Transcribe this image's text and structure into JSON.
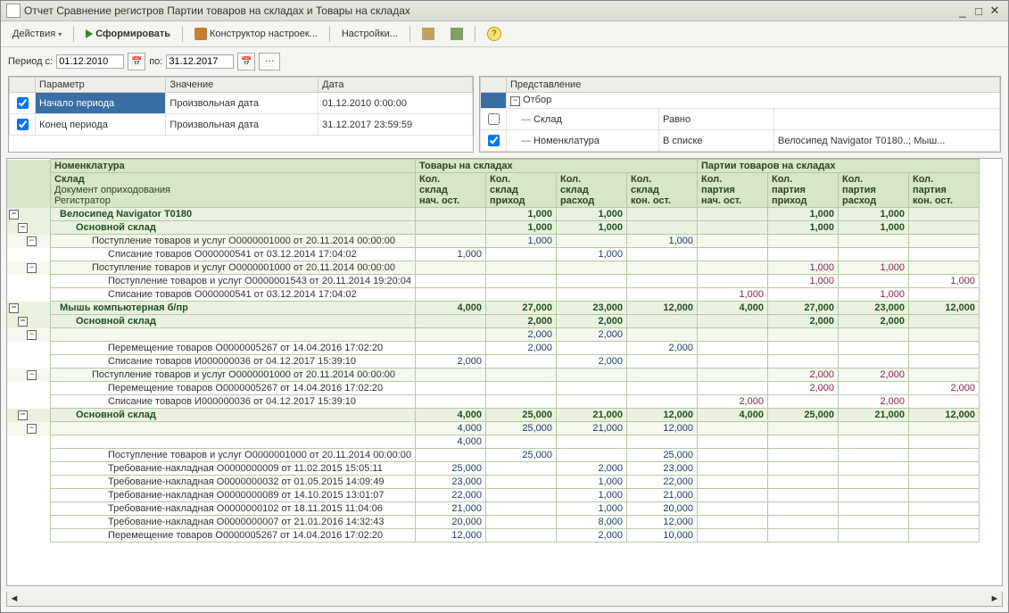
{
  "window": {
    "title": "Отчет  Сравнение регистров Партии товаров на складах и Товары на складах"
  },
  "toolbar": {
    "actions": "Действия",
    "form": "Сформировать",
    "constructor": "Конструктор настроек...",
    "settings": "Настройки..."
  },
  "period": {
    "label_from": "Период с:",
    "from": "01.12.2010",
    "label_to": "по:",
    "to": "31.12.2017"
  },
  "left_panel": {
    "h_param": "Параметр",
    "h_value": "Значение",
    "h_date": "Дата",
    "rows": [
      {
        "chk": true,
        "param": "Начало периода",
        "value": "Произвольная дата",
        "date": "01.12.2010 0:00:00",
        "sel": true
      },
      {
        "chk": true,
        "param": "Конец периода",
        "value": "Произвольная дата",
        "date": "31.12.2017 23:59:59"
      }
    ]
  },
  "right_panel": {
    "h_view": "Представление",
    "root": "Отбор",
    "rows": [
      {
        "chk": false,
        "name": "Склад",
        "comp": "Равно",
        "val": ""
      },
      {
        "chk": true,
        "name": "Номенклатура",
        "comp": "В списке",
        "val": "Велосипед Navigator Т0180..; Мыш..."
      }
    ]
  },
  "report": {
    "head_col1": [
      "Номенклатура",
      "Склад",
      "Документ оприходования",
      "Регистратор"
    ],
    "group1": "Товары на складах",
    "group2": "Партии товаров на складах",
    "cols_g1": [
      "Кол. склад нач. ост.",
      "Кол. склад приход",
      "Кол. склад расход",
      "Кол. склад кон. ост."
    ],
    "cols_g2": [
      "Кол. партия нач. ост.",
      "Кол. партия приход",
      "Кол. партия расход",
      "Кол. партия кон. ост."
    ],
    "rows": [
      {
        "lvl": 0,
        "label": "Велосипед Navigator Т0180",
        "v": [
          "",
          "1,000",
          "1,000",
          "",
          "",
          "1,000",
          "1,000",
          ""
        ],
        "p": [
          0,
          0,
          0,
          0,
          0,
          1,
          1,
          0
        ]
      },
      {
        "lvl": 1,
        "label": "Основной склад",
        "v": [
          "",
          "1,000",
          "1,000",
          "",
          "",
          "1,000",
          "1,000",
          ""
        ],
        "p": [
          0,
          0,
          0,
          0,
          0,
          1,
          1,
          0
        ]
      },
      {
        "lvl": 2,
        "label": "Поступление товаров и услуг О0000001000 от 20.11.2014 00:00:00",
        "v": [
          "",
          "1,000",
          "",
          "1,000",
          "",
          "",
          "",
          ""
        ]
      },
      {
        "lvl": 3,
        "label": "Списание товаров О000000541 от 03.12.2014 17:04:02",
        "v": [
          "1,000",
          "",
          "1,000",
          "",
          "",
          "",
          "",
          ""
        ]
      },
      {
        "lvl": 2,
        "label": "Поступление товаров и услуг О0000001000 от 20.11.2014 00:00:00",
        "v": [
          "",
          "",
          "",
          "",
          "",
          "1,000",
          "1,000",
          ""
        ],
        "p": [
          0,
          0,
          0,
          0,
          0,
          1,
          1,
          0
        ]
      },
      {
        "lvl": 3,
        "label": "Поступление товаров и услуг О0000001543 от 20.11.2014 19:20:04",
        "v": [
          "",
          "",
          "",
          "",
          "",
          "1,000",
          "",
          "1,000"
        ],
        "p": [
          0,
          0,
          0,
          0,
          0,
          1,
          0,
          1
        ]
      },
      {
        "lvl": 3,
        "label": "Списание товаров О000000541 от 03.12.2014 17:04:02",
        "v": [
          "",
          "",
          "",
          "",
          "1,000",
          "",
          "1,000",
          ""
        ],
        "p": [
          0,
          0,
          0,
          0,
          1,
          0,
          1,
          0
        ]
      },
      {
        "lvl": 0,
        "label": "Мышь компьютерная б/пр",
        "v": [
          "4,000",
          "27,000",
          "23,000",
          "12,000",
          "4,000",
          "27,000",
          "23,000",
          "12,000"
        ],
        "p": [
          0,
          0,
          0,
          0,
          1,
          1,
          1,
          1
        ]
      },
      {
        "lvl": 1,
        "label": "Основной склад",
        "v": [
          "",
          "2,000",
          "2,000",
          "",
          "",
          "2,000",
          "2,000",
          ""
        ],
        "p": [
          0,
          0,
          0,
          0,
          0,
          1,
          1,
          0
        ]
      },
      {
        "lvl": 2,
        "label": "",
        "v": [
          "",
          "2,000",
          "2,000",
          "",
          "",
          "",
          "",
          ""
        ]
      },
      {
        "lvl": 3,
        "label": "Перемещение товаров О0000005267 от 14.04.2016 17:02:20",
        "v": [
          "",
          "2,000",
          "",
          "2,000",
          "",
          "",
          "",
          ""
        ]
      },
      {
        "lvl": 3,
        "label": "Списание товаров И000000036 от 04.12.2017 15:39:10",
        "v": [
          "2,000",
          "",
          "2,000",
          "",
          "",
          "",
          "",
          ""
        ]
      },
      {
        "lvl": 2,
        "label": "Поступление товаров и услуг О0000001000 от 20.11.2014 00:00:00",
        "v": [
          "",
          "",
          "",
          "",
          "",
          "2,000",
          "2,000",
          ""
        ],
        "p": [
          0,
          0,
          0,
          0,
          0,
          1,
          1,
          0
        ]
      },
      {
        "lvl": 3,
        "label": "Перемещение товаров О0000005267 от 14.04.2016 17:02:20",
        "v": [
          "",
          "",
          "",
          "",
          "",
          "2,000",
          "",
          "2,000"
        ],
        "p": [
          0,
          0,
          0,
          0,
          0,
          1,
          0,
          1
        ]
      },
      {
        "lvl": 3,
        "label": "Списание товаров И000000036 от 04.12.2017 15:39:10",
        "v": [
          "",
          "",
          "",
          "",
          "2,000",
          "",
          "2,000",
          ""
        ],
        "p": [
          0,
          0,
          0,
          0,
          1,
          0,
          1,
          0
        ]
      },
      {
        "lvl": 1,
        "label": "Основной склад",
        "v": [
          "4,000",
          "25,000",
          "21,000",
          "12,000",
          "4,000",
          "25,000",
          "21,000",
          "12,000"
        ],
        "p": [
          0,
          0,
          0,
          0,
          1,
          1,
          1,
          1
        ]
      },
      {
        "lvl": 2,
        "label": "",
        "v": [
          "4,000",
          "25,000",
          "21,000",
          "12,000",
          "",
          "",
          "",
          ""
        ]
      },
      {
        "lvl": 3,
        "label": "",
        "v": [
          "4,000",
          "",
          "",
          "",
          "",
          "",
          "",
          ""
        ]
      },
      {
        "lvl": 3,
        "label": "Поступление товаров и услуг О0000001000 от 20.11.2014 00:00:00",
        "v": [
          "",
          "25,000",
          "",
          "25,000",
          "",
          "",
          "",
          ""
        ]
      },
      {
        "lvl": 3,
        "label": "Требование-накладная О0000000009 от 11.02.2015 15:05:11",
        "v": [
          "25,000",
          "",
          "2,000",
          "23,000",
          "",
          "",
          "",
          ""
        ]
      },
      {
        "lvl": 3,
        "label": "Требование-накладная О0000000032 от 01.05.2015 14:09:49",
        "v": [
          "23,000",
          "",
          "1,000",
          "22,000",
          "",
          "",
          "",
          ""
        ]
      },
      {
        "lvl": 3,
        "label": "Требование-накладная О0000000089 от 14.10.2015 13:01:07",
        "v": [
          "22,000",
          "",
          "1,000",
          "21,000",
          "",
          "",
          "",
          ""
        ]
      },
      {
        "lvl": 3,
        "label": "Требование-накладная О0000000102 от 18.11.2015 11:04:06",
        "v": [
          "21,000",
          "",
          "1,000",
          "20,000",
          "",
          "",
          "",
          ""
        ]
      },
      {
        "lvl": 3,
        "label": "Требование-накладная О0000000007 от 21.01.2016 14:32:43",
        "v": [
          "20,000",
          "",
          "8,000",
          "12,000",
          "",
          "",
          "",
          ""
        ]
      },
      {
        "lvl": 3,
        "label": "Перемещение товаров О0000005267 от 14.04.2016 17:02:20",
        "v": [
          "12,000",
          "",
          "2,000",
          "10,000",
          "",
          "",
          "",
          ""
        ]
      }
    ]
  }
}
